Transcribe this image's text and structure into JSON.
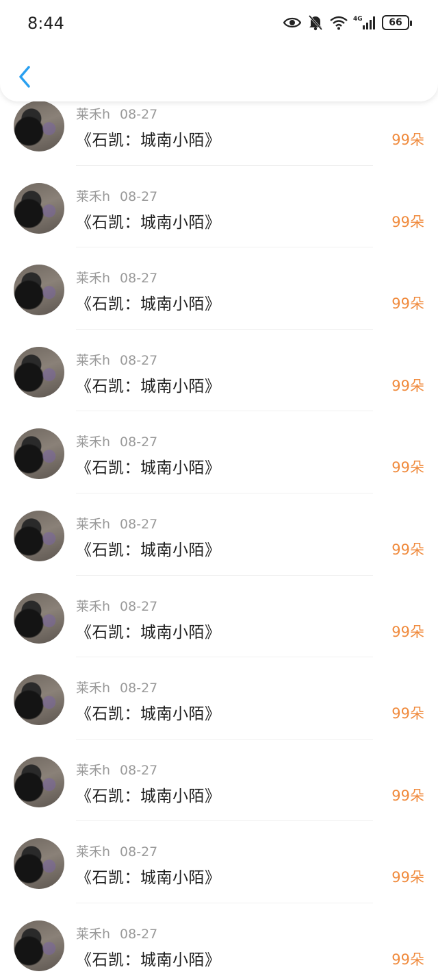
{
  "status_bar": {
    "time": "8:44",
    "network": "4G",
    "battery": "66",
    "icons": [
      "eye-icon",
      "bell-off-icon",
      "wifi-icon",
      "signal-icon",
      "battery-icon"
    ]
  },
  "nav": {
    "back_icon": "chevron-left-icon",
    "accent": "#2aa0f0"
  },
  "colors": {
    "count": "#f08a3c",
    "meta": "#9a9a9a",
    "title": "#1e1e1e"
  },
  "items": [
    {
      "user": "莱禾h",
      "date": "08-27",
      "title": "《石凯：城南小陌》",
      "count": "99朵"
    },
    {
      "user": "莱禾h",
      "date": "08-27",
      "title": "《石凯：城南小陌》",
      "count": "99朵"
    },
    {
      "user": "莱禾h",
      "date": "08-27",
      "title": "《石凯：城南小陌》",
      "count": "99朵"
    },
    {
      "user": "莱禾h",
      "date": "08-27",
      "title": "《石凯：城南小陌》",
      "count": "99朵"
    },
    {
      "user": "莱禾h",
      "date": "08-27",
      "title": "《石凯：城南小陌》",
      "count": "99朵"
    },
    {
      "user": "莱禾h",
      "date": "08-27",
      "title": "《石凯：城南小陌》",
      "count": "99朵"
    },
    {
      "user": "莱禾h",
      "date": "08-27",
      "title": "《石凯：城南小陌》",
      "count": "99朵"
    },
    {
      "user": "莱禾h",
      "date": "08-27",
      "title": "《石凯：城南小陌》",
      "count": "99朵"
    },
    {
      "user": "莱禾h",
      "date": "08-27",
      "title": "《石凯：城南小陌》",
      "count": "99朵"
    },
    {
      "user": "莱禾h",
      "date": "08-27",
      "title": "《石凯：城南小陌》",
      "count": "99朵"
    },
    {
      "user": "莱禾h",
      "date": "08-27",
      "title": "《石凯：城南小陌》",
      "count": "99朵"
    }
  ]
}
